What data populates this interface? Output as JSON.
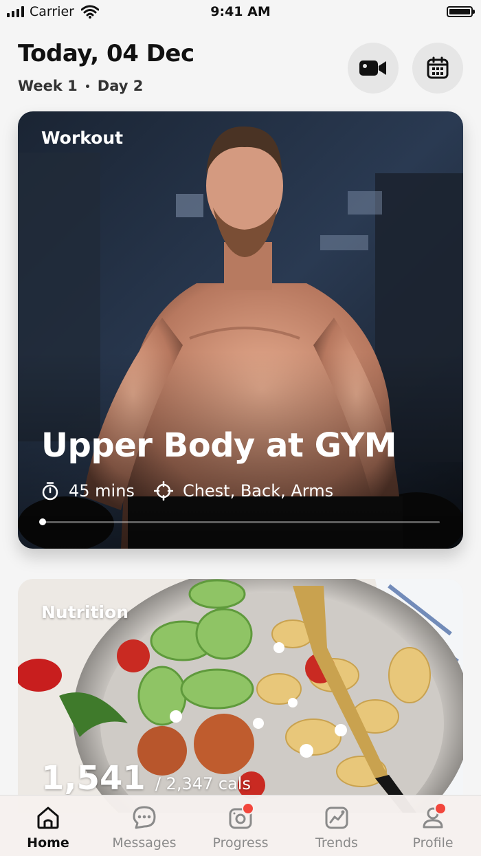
{
  "status_bar": {
    "carrier": "Carrier",
    "time": "9:41 AM"
  },
  "header": {
    "title": "Today, 04 Dec",
    "week": "Week 1",
    "day": "Day 2",
    "video_button_icon": "video-camera-icon",
    "calendar_button_icon": "calendar-icon"
  },
  "workout": {
    "label": "Workout",
    "title": "Upper Body at GYM",
    "duration": "45 mins",
    "muscles": "Chest, Back, Arms",
    "progress": 0.0
  },
  "nutrition": {
    "label": "Nutrition",
    "calories_consumed": "1,541",
    "calories_total": "/ 2,347 cals"
  },
  "tabs": [
    {
      "label": "Home",
      "icon": "home-icon",
      "active": true,
      "badge": false
    },
    {
      "label": "Messages",
      "icon": "chat-icon",
      "active": false,
      "badge": false
    },
    {
      "label": "Progress",
      "icon": "progress-camera-icon",
      "active": false,
      "badge": true
    },
    {
      "label": "Trends",
      "icon": "trends-icon",
      "active": false,
      "badge": false
    },
    {
      "label": "Profile",
      "icon": "profile-icon",
      "active": false,
      "badge": true
    }
  ],
  "colors": {
    "badge": "#f2463c",
    "active_tab": "#111111",
    "inactive_tab": "#8a8a8a"
  }
}
